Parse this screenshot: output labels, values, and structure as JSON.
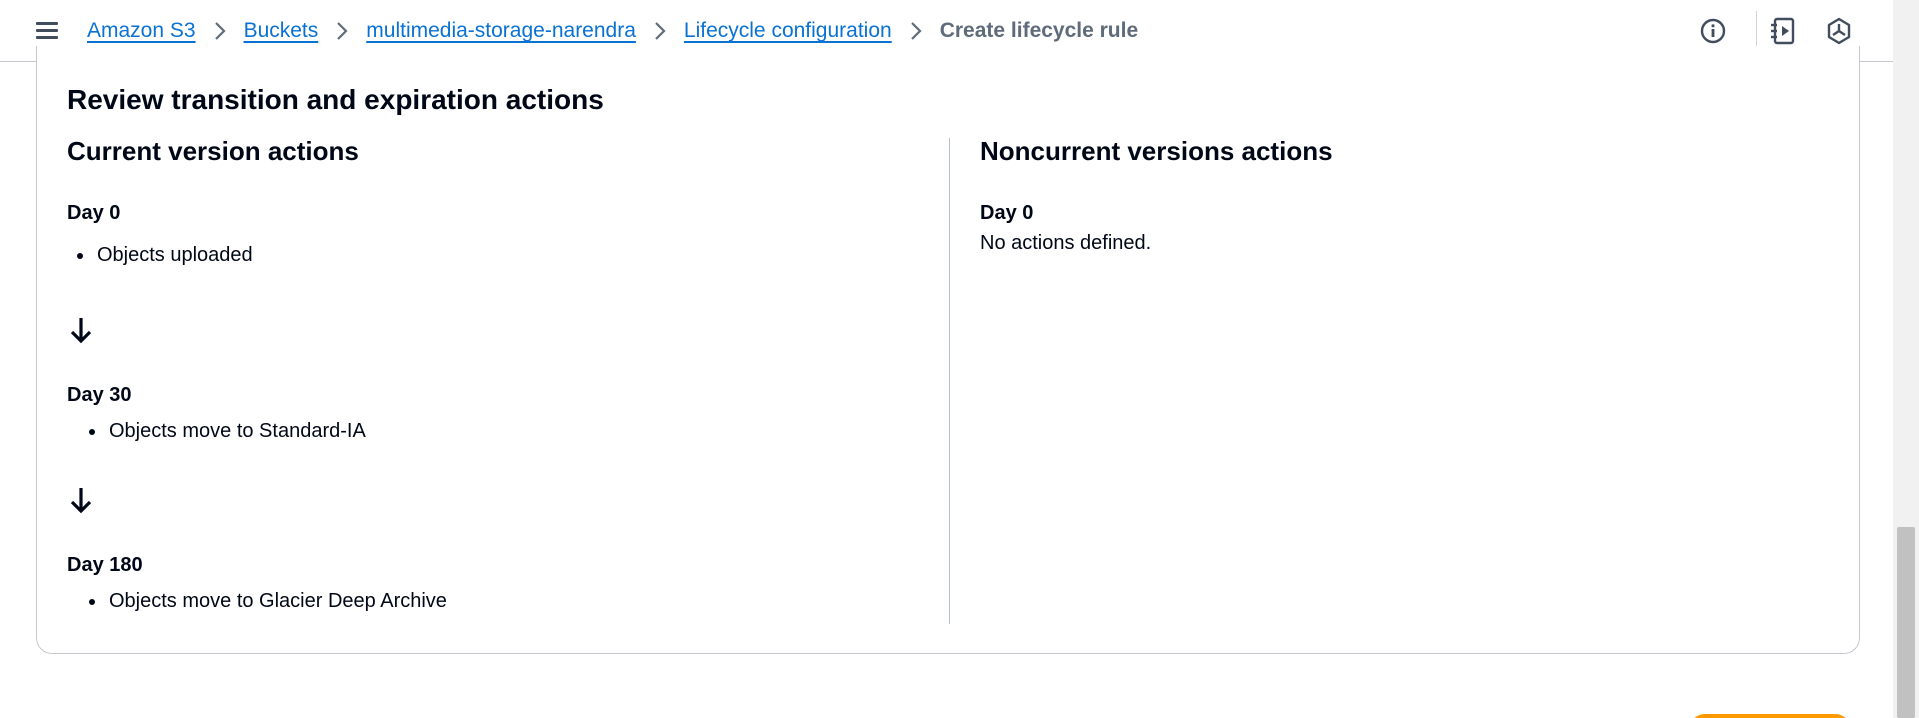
{
  "breadcrumb": {
    "items": [
      "Amazon S3",
      "Buckets",
      "multimedia-storage-narendra",
      "Lifecycle configuration"
    ],
    "current": "Create lifecycle rule"
  },
  "icons": {
    "menu": "hamburger-menu-icon",
    "info": "info-icon",
    "notifications": "notifications-panel-icon",
    "settings": "hexagon-settings-icon"
  },
  "card": {
    "title": "Review transition and expiration actions",
    "current": {
      "heading": "Current version actions",
      "steps": [
        {
          "day": "Day 0",
          "action": "Objects uploaded"
        },
        {
          "day": "Day 30",
          "action": "Objects move to Standard-IA"
        },
        {
          "day": "Day 180",
          "action": "Objects move to Glacier Deep Archive"
        }
      ]
    },
    "noncurrent": {
      "heading": "Noncurrent versions actions",
      "day": "Day 0",
      "message": "No actions defined."
    }
  },
  "colors": {
    "link": "#0972d3",
    "text": "#000716",
    "muted": "#5f6b7a",
    "primary_button": "#ff9900"
  }
}
